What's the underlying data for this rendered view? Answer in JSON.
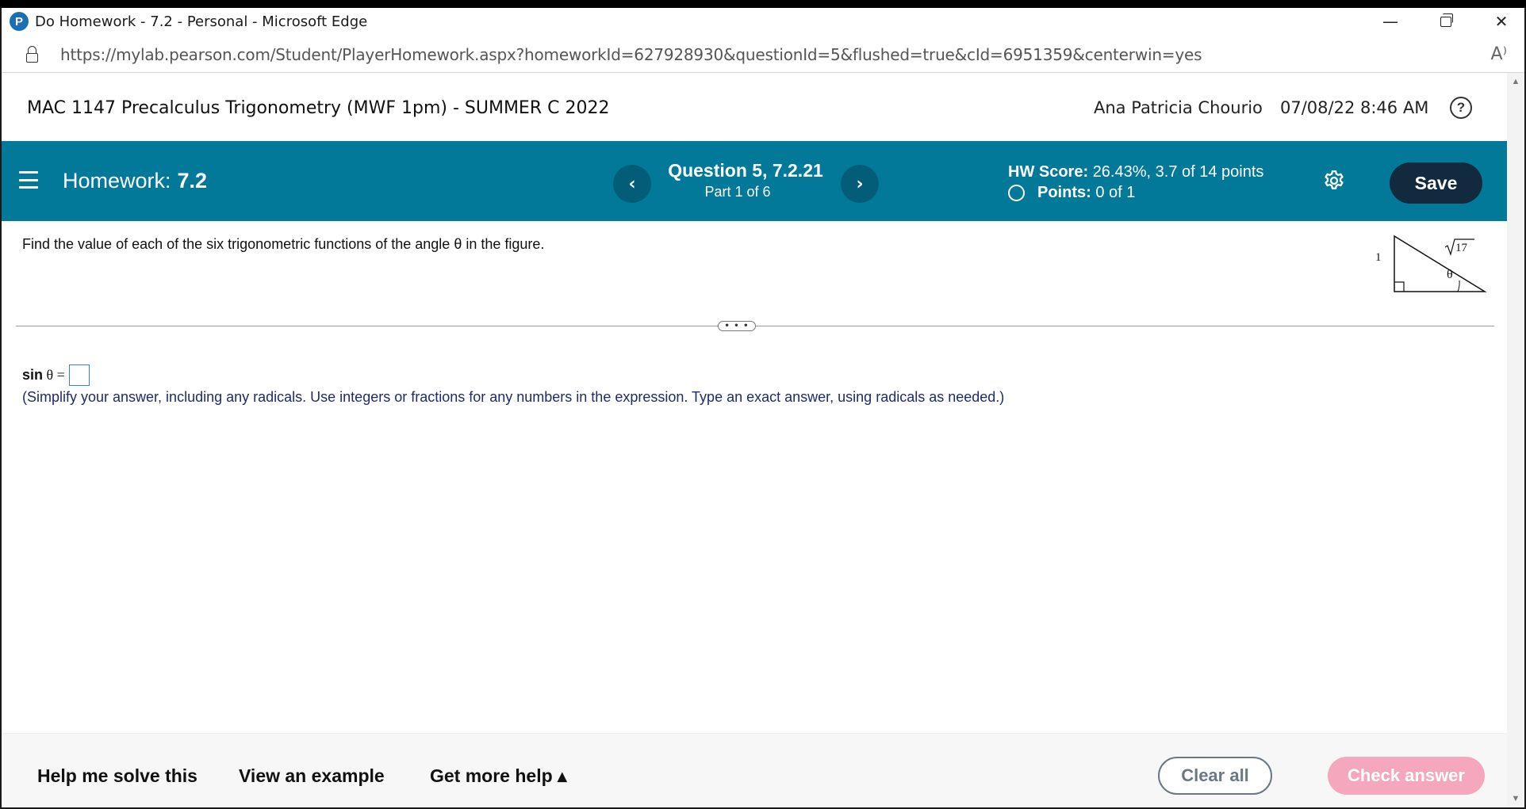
{
  "window": {
    "title": "Do Homework - 7.2 - Personal - Microsoft Edge",
    "app_icon": "P",
    "controls": {
      "minimize": "—",
      "close": "✕"
    }
  },
  "address": {
    "url": "https://mylab.pearson.com/Student/PlayerHomework.aspx?homeworkId=627928930&questionId=5&flushed=true&cId=6951359&centerwin=yes",
    "read_aloud_icon": "A⁾"
  },
  "course": {
    "title": "MAC 1147 Precalculus Trigonometry (MWF 1pm) - SUMMER C 2022",
    "student_name": "Ana Patricia Chourio",
    "datetime": "07/08/22 8:46 AM",
    "help_icon": "?"
  },
  "hw_bar": {
    "homework_label": "Homework:",
    "homework_value": "7.2",
    "prev_icon": "‹",
    "next_icon": "›",
    "question": "Question 5, 7.2.21",
    "part": "Part 1 of 6",
    "score_label": "HW Score:",
    "score_value": "26.43%, 3.7 of 14 points",
    "points_label": "Points:",
    "points_value": "0 of 1",
    "save_label": "Save",
    "accent_color": "#03799a"
  },
  "question": {
    "prompt": "Find the value of each of the six trigonometric functions of the angle θ in the figure.",
    "figure": {
      "side_vertical": "1",
      "hypotenuse": "17",
      "angle": "θ"
    },
    "divider_handle": "• • •",
    "answer_fn": "sin",
    "answer_theta": "θ =",
    "instructions": "(Simplify your answer, including any radicals. Use integers or fractions for any numbers in the expression. Type an exact answer, using radicals as needed.)"
  },
  "footer": {
    "help_solve": "Help me solve this",
    "view_example": "View an example",
    "more_help": "Get more help ▴",
    "clear_all": "Clear all",
    "check_answer": "Check answer"
  }
}
